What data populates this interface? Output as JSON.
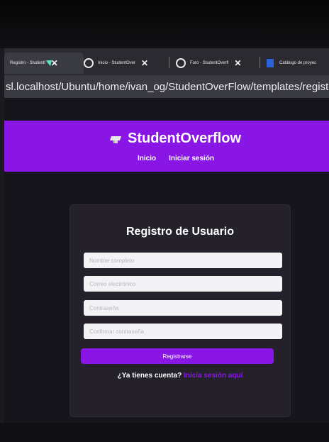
{
  "browser": {
    "tabs": [
      {
        "label": "Registro - Studentl",
        "close": "✕"
      },
      {
        "label": "Inicio - StudentOver",
        "close": "✕"
      },
      {
        "label": "Foro - StudentOverfl",
        "close": "✕"
      },
      {
        "label": "Catálogo de proyec",
        "close": ""
      }
    ],
    "url": "sl.localhost/Ubuntu/home/ivan_og/StudentOverFlow/templates/register.htm"
  },
  "header": {
    "brand": "StudentOverflow",
    "nav": [
      "Inicio",
      "Iniciar sesión"
    ]
  },
  "form": {
    "title": "Registro de Usuario",
    "placeholders": {
      "full_name": "Nombre completo",
      "email": "Correo electrónico",
      "password": "Contraseña",
      "confirm_password": "Confirmar contraseña"
    },
    "submit": "Registrarse",
    "login_prompt": "¿Ya tienes cuenta?",
    "login_link": "Inicia sesión aquí"
  },
  "colors": {
    "accent": "#8a16e6",
    "background": "#17151c",
    "card": "#24212a"
  }
}
